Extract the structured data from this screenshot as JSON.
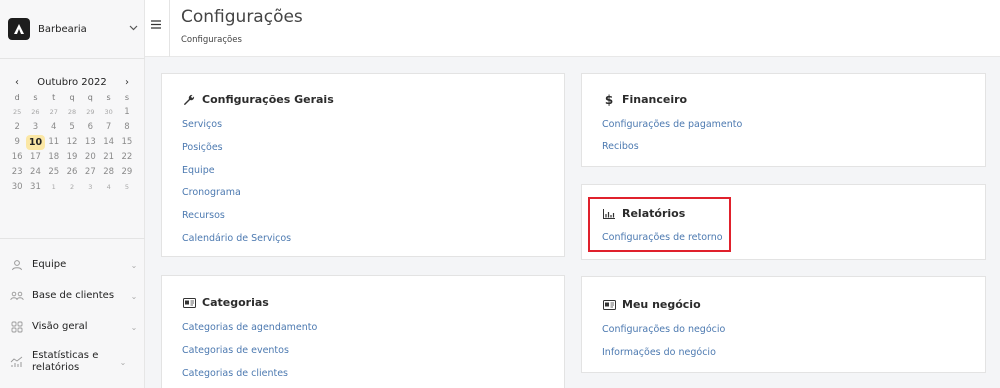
{
  "sidebar": {
    "brand": {
      "name": "Barbearia"
    },
    "calendar": {
      "month_label": "Outubro 2022",
      "prev_label": "‹",
      "next_label": "›",
      "weekdays": [
        "d",
        "s",
        "t",
        "q",
        "q",
        "s",
        "s"
      ],
      "weeks": [
        [
          "25",
          "26",
          "27",
          "28",
          "29",
          "30",
          "1"
        ],
        [
          "2",
          "3",
          "4",
          "5",
          "6",
          "7",
          "8"
        ],
        [
          "9",
          "10",
          "11",
          "12",
          "13",
          "14",
          "15"
        ],
        [
          "16",
          "17",
          "18",
          "19",
          "20",
          "21",
          "22"
        ],
        [
          "23",
          "24",
          "25",
          "26",
          "27",
          "28",
          "29"
        ],
        [
          "30",
          "31",
          "1",
          "2",
          "3",
          "4",
          "5"
        ]
      ],
      "today": "10"
    },
    "nav": [
      {
        "label": "Equipe",
        "icon": "person-icon"
      },
      {
        "label": "Base de clientes",
        "icon": "clients-icon"
      },
      {
        "label": "Visão geral",
        "icon": "grid-icon"
      },
      {
        "label": "Estatísticas e relatórios",
        "icon": "stats-icon"
      }
    ]
  },
  "header": {
    "menu_icon": "hamburger-icon",
    "title": "Configurações",
    "breadcrumb": "Configurações"
  },
  "cards": {
    "geral": {
      "title": "Configurações Gerais",
      "icon": "wrench-icon",
      "links": [
        "Serviços",
        "Posições",
        "Equipe",
        "Cronograma",
        "Recursos",
        "Calendário de Serviços"
      ]
    },
    "financeiro": {
      "title": "Financeiro",
      "icon": "dollar-icon",
      "links": [
        "Configurações de pagamento",
        "Recibos"
      ]
    },
    "relatorios": {
      "title": "Relatórios",
      "icon": "chart-icon",
      "links": [
        "Configurações de retorno"
      ]
    },
    "categorias": {
      "title": "Categorias",
      "icon": "id-card-icon",
      "links": [
        "Categorias de agendamento",
        "Categorias de eventos",
        "Categorias de clientes"
      ]
    },
    "negocio": {
      "title": "Meu negócio",
      "icon": "id-card-icon",
      "links": [
        "Configurações do negócio",
        "Informações do negócio"
      ]
    }
  },
  "colors": {
    "link": "#4c79b0",
    "highlight": "#e0212c",
    "today_bg": "#fbe7a5"
  }
}
